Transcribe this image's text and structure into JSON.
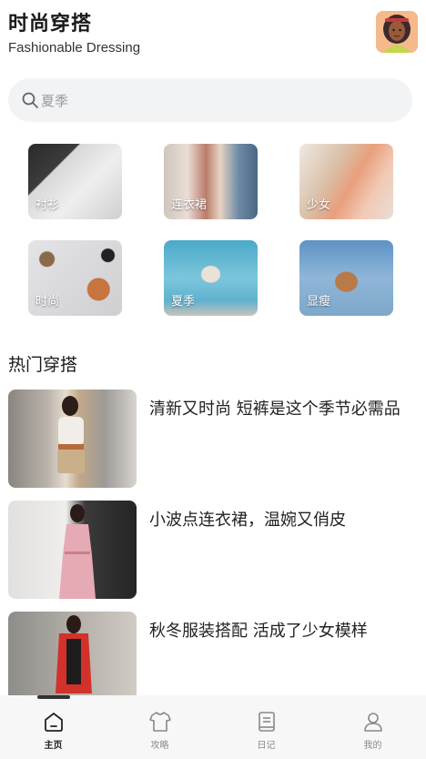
{
  "header": {
    "title": "时尚穿搭",
    "subtitle": "Fashionable Dressing"
  },
  "avatar": {
    "icon": "woman-avatar-icon"
  },
  "search": {
    "icon": "search-icon",
    "text": "夏季"
  },
  "categories": [
    {
      "label": "衬衫"
    },
    {
      "label": "连衣裙"
    },
    {
      "label": "少女"
    },
    {
      "label": "时尚"
    },
    {
      "label": "夏季"
    },
    {
      "label": "显瘦"
    }
  ],
  "section": {
    "title": "热门穿搭"
  },
  "articles": [
    {
      "title": "清新又时尚  短裤是这个季节必需品"
    },
    {
      "title": "小波点连衣裙，温婉又俏皮"
    },
    {
      "title": "秋冬服装搭配 活成了少女模样"
    }
  ],
  "tabs": [
    {
      "label": "主页",
      "icon": "home-icon",
      "active": true
    },
    {
      "label": "攻略",
      "icon": "tshirt-icon",
      "active": false
    },
    {
      "label": "日记",
      "icon": "notebook-icon",
      "active": false
    },
    {
      "label": "我的",
      "icon": "user-icon",
      "active": false
    }
  ],
  "colors": {
    "search_bg": "#f2f3f5",
    "tabbar_bg": "#f7f7f8",
    "underline": "#fde2c8"
  }
}
